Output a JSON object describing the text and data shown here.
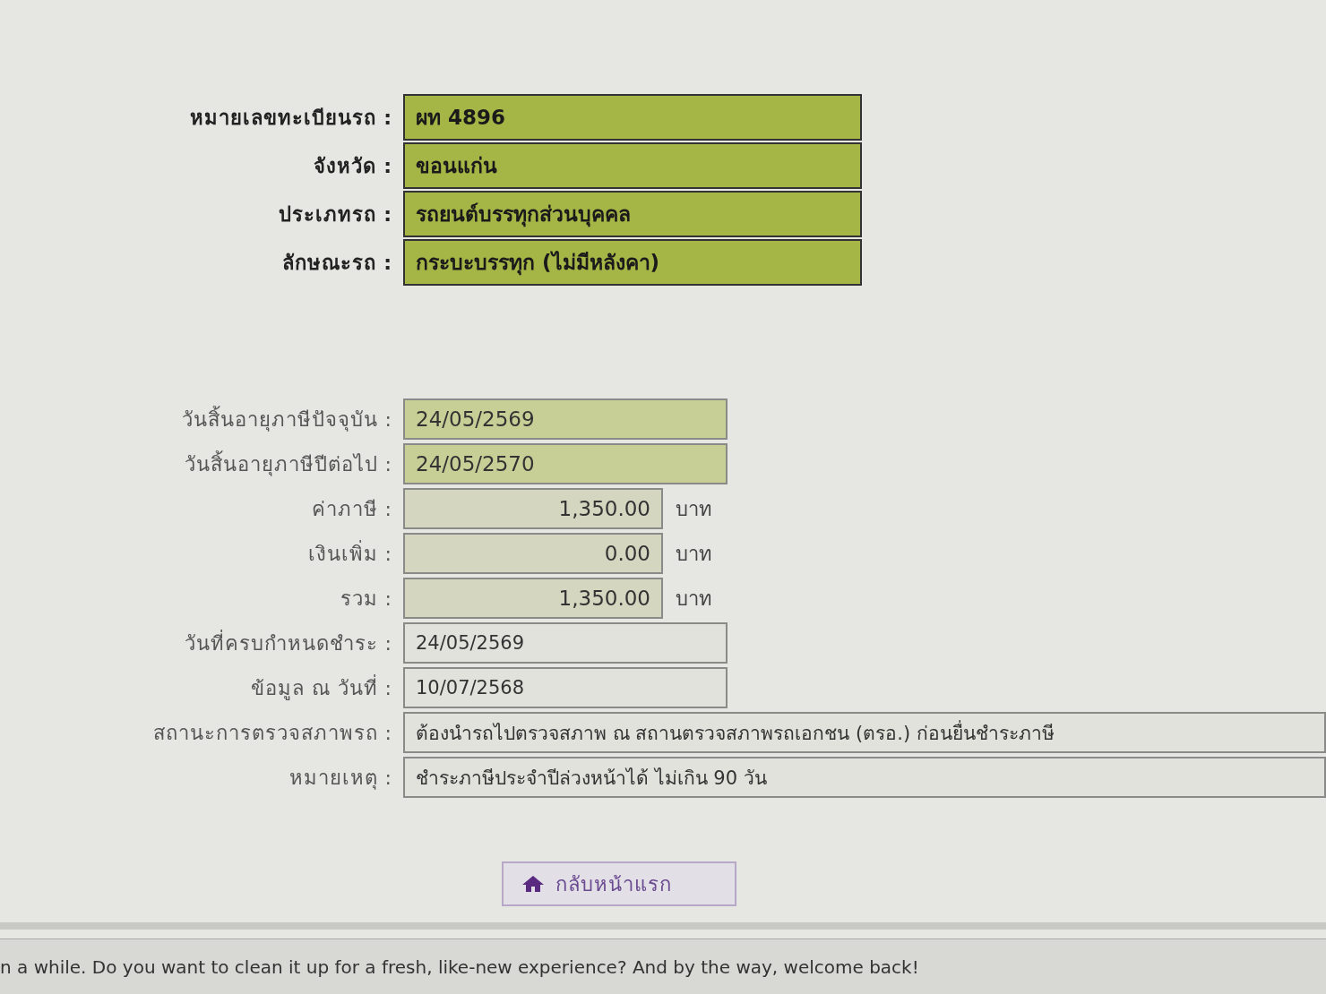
{
  "vehicle": [
    {
      "label": "หมายเลขทะเบียนรถ :",
      "value": "ผท 4896",
      "kind": "strong"
    },
    {
      "label": "จังหวัด :",
      "value": "ขอนแก่น",
      "kind": "strong"
    },
    {
      "label": "ประเภทรถ :",
      "value": "รถยนต์บรรทุกส่วนบุคคล",
      "kind": "strong"
    },
    {
      "label": "ลักษณะรถ :",
      "value": "กระบะบรรทุก (ไม่มีหลังคา)",
      "kind": "strong"
    }
  ],
  "tax": [
    {
      "label": "วันสิ้นอายุภาษีปัจจุบัน :",
      "value": "24/05/2569",
      "kind": "light"
    },
    {
      "label": "วันสิ้นอายุภาษีปีต่อไป :",
      "value": "24/05/2570",
      "kind": "light"
    },
    {
      "label": "ค่าภาษี :",
      "value": "1,350.00",
      "kind": "amount",
      "unit": "บาท"
    },
    {
      "label": "เงินเพิ่ม :",
      "value": "0.00",
      "kind": "amount",
      "unit": "บาท"
    },
    {
      "label": "รวม :",
      "value": "1,350.00",
      "kind": "amount",
      "unit": "บาท"
    },
    {
      "label": "วันที่ครบกำหนดชำระ :",
      "value": "24/05/2569",
      "kind": "plain"
    },
    {
      "label": "ข้อมูล ณ วันที่ :",
      "value": "10/07/2568",
      "kind": "plain"
    },
    {
      "label": "สถานะการตรวจสภาพรถ :",
      "value": "ต้องนำรถไปตรวจสภาพ ณ สถานตรวจสภาพรถเอกชน (ตรอ.) ก่อนยื่นชำระภาษี",
      "kind": "note"
    },
    {
      "label": "หมายเหตุ :",
      "value": "ชำระภาษีประจำปีล่วงหน้าได้ ไม่เกิน 90 วัน",
      "kind": "note"
    }
  ],
  "home_button": {
    "label": "กลับหน้าแรก"
  },
  "notification": {
    "text": "n a while. Do you want to clean it up for a fresh, like-new experience? And by the way, welcome back!"
  }
}
